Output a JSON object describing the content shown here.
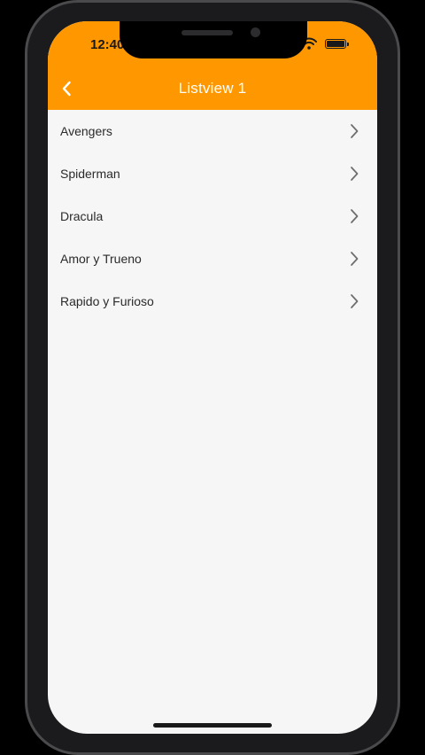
{
  "status_bar": {
    "time": "12:40"
  },
  "nav_bar": {
    "title": "Listview 1",
    "background_color": "#ff9800",
    "back_icon": "chevron-left-icon"
  },
  "list": {
    "items": [
      {
        "label": "Avengers"
      },
      {
        "label": "Spiderman"
      },
      {
        "label": "Dracula"
      },
      {
        "label": "Amor y Trueno"
      },
      {
        "label": "Rapido y Furioso"
      }
    ],
    "trailing_icon": "chevron-right-icon"
  }
}
